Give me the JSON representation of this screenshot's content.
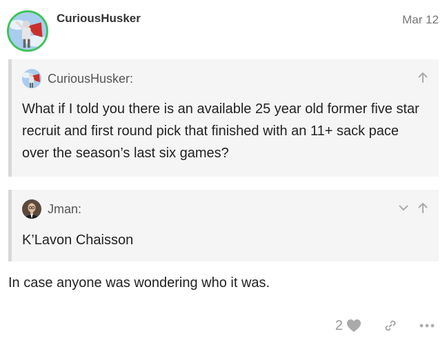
{
  "post": {
    "author": "CuriousHusker",
    "date": "Mar 12",
    "avatar_icon": "superhero-avatar-icon",
    "quotes": [
      {
        "author": "CuriousHusker:",
        "avatar_icon": "superhero-avatar-icon",
        "text": "What if I told you there is an available 25 year old former five star recruit and first round pick that finished with an 11+ sack pace over the season’s last six games?",
        "actions": [
          "arrow-up-icon"
        ]
      },
      {
        "author": "Jman:",
        "avatar_icon": "man-in-suit-avatar-icon",
        "text": "K’Lavon Chaisson",
        "actions": [
          "chevron-down-icon",
          "arrow-up-icon"
        ]
      }
    ],
    "body": "In case anyone was wondering who it was.",
    "controls": {
      "like_count": "2",
      "icons": [
        "heart-icon",
        "link-icon",
        "more-icon"
      ]
    }
  },
  "colors": {
    "avatar_ring": "#3ec35a",
    "quote_bg": "#f5f5f5",
    "quote_border": "#d8d8d8",
    "muted_text": "#999999",
    "icon_gray": "#aaaaaa"
  }
}
